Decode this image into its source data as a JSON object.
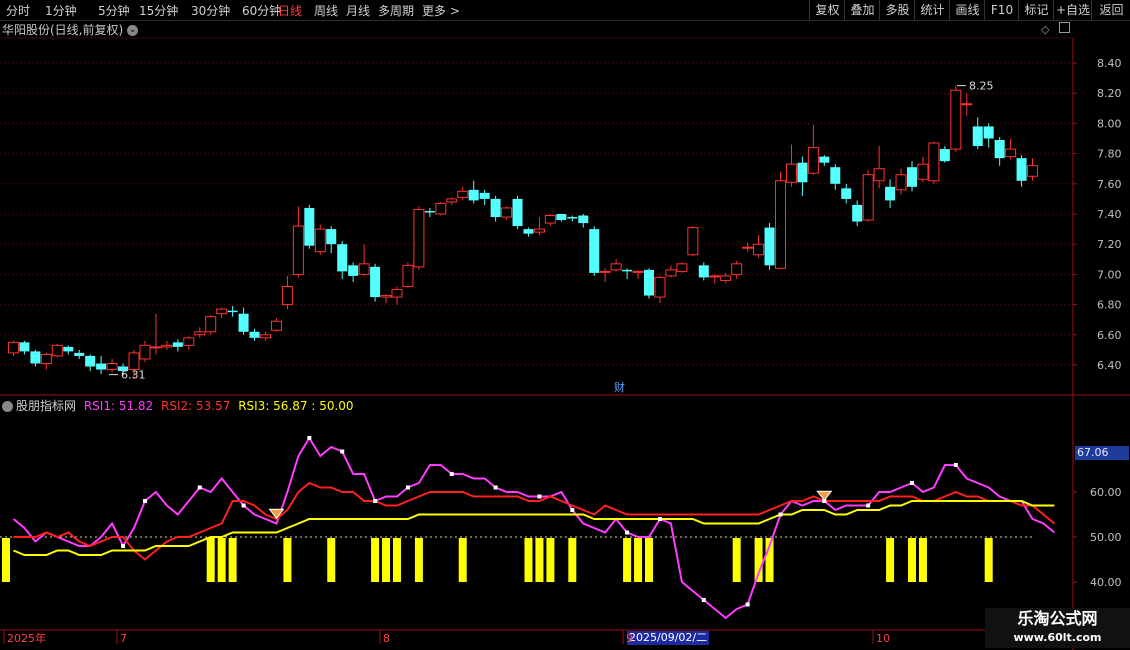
{
  "toolbar": {
    "periods": [
      "分时",
      "1分钟",
      "5分钟",
      "15分钟",
      "30分钟",
      "60分钟",
      "日线",
      "周线",
      "月线",
      "多周期",
      "更多 >"
    ],
    "active_period": "日线",
    "right_buttons": [
      "复权",
      "叠加",
      "多股",
      "统计",
      "画线",
      "F10",
      "标记",
      "+自选",
      "返回"
    ]
  },
  "main_title": "华阳股份(日线,前复权)",
  "indicator": {
    "name": "股朋指标网",
    "rsi1_label": "RSI1: 51.82",
    "rsi2_label": "RSI2: 53.57",
    "rsi3_label": "RSI3: 56.87",
    "ref_label": ": 50.00",
    "readout": "67.06"
  },
  "colors": {
    "up": "#ff3232",
    "down": "#54ffff",
    "rsi1": "#ff3cff",
    "rsi2": "#ff2020",
    "rsi3": "#ffff00",
    "axis": "#a01010",
    "bars": "#ffff00"
  },
  "x_labels": [
    "2025年",
    "7",
    "8",
    "9",
    "10"
  ],
  "date_tag": "2025/09/02/二",
  "event_markers": [
    "",
    "财"
  ],
  "watermark": {
    "line1": "乐淘公式网",
    "line2": "www.60lt.com"
  },
  "chart_data": [
    {
      "type": "candlestick",
      "title": "华阳股份(日线,前复权)",
      "ylim": [
        6.3,
        8.5
      ],
      "y_ticks": [
        6.4,
        6.6,
        6.8,
        7.0,
        7.2,
        7.4,
        7.6,
        7.8,
        8.0,
        8.2,
        8.4
      ],
      "annotations": [
        {
          "text": "8.25",
          "value": 8.25
        },
        {
          "text": "6.31",
          "value": 6.31
        }
      ],
      "candles": [
        [
          6.48,
          6.55,
          6.56,
          6.46
        ],
        [
          6.55,
          6.49,
          6.56,
          6.47
        ],
        [
          6.49,
          6.41,
          6.5,
          6.39
        ],
        [
          6.41,
          6.47,
          6.48,
          6.37
        ],
        [
          6.46,
          6.53,
          6.54,
          6.45
        ],
        [
          6.52,
          6.49,
          6.53,
          6.47
        ],
        [
          6.48,
          6.46,
          6.5,
          6.44
        ],
        [
          6.46,
          6.39,
          6.47,
          6.36
        ],
        [
          6.41,
          6.37,
          6.46,
          6.34
        ],
        [
          6.37,
          6.41,
          6.44,
          6.35
        ],
        [
          6.39,
          6.36,
          6.41,
          6.33
        ],
        [
          6.37,
          6.48,
          6.5,
          6.31
        ],
        [
          6.44,
          6.53,
          6.56,
          6.42
        ],
        [
          6.52,
          6.52,
          6.74,
          6.47
        ],
        [
          6.52,
          6.53,
          6.56,
          6.5
        ],
        [
          6.55,
          6.52,
          6.57,
          6.49
        ],
        [
          6.53,
          6.58,
          6.59,
          6.5
        ],
        [
          6.6,
          6.62,
          6.65,
          6.58
        ],
        [
          6.62,
          6.72,
          6.73,
          6.6
        ],
        [
          6.74,
          6.77,
          6.78,
          6.71
        ],
        [
          6.76,
          6.75,
          6.79,
          6.72
        ],
        [
          6.74,
          6.62,
          6.78,
          6.6
        ],
        [
          6.62,
          6.58,
          6.64,
          6.56
        ],
        [
          6.58,
          6.6,
          6.62,
          6.56
        ],
        [
          6.63,
          6.69,
          6.71,
          6.62
        ],
        [
          6.8,
          6.92,
          6.99,
          6.77
        ],
        [
          7.0,
          7.32,
          7.45,
          6.98
        ],
        [
          7.44,
          7.19,
          7.46,
          7.17
        ],
        [
          7.15,
          7.3,
          7.33,
          7.13
        ],
        [
          7.3,
          7.2,
          7.32,
          7.14
        ],
        [
          7.2,
          7.02,
          7.22,
          6.97
        ],
        [
          7.06,
          6.99,
          7.08,
          6.95
        ],
        [
          7.0,
          7.07,
          7.2,
          6.99
        ],
        [
          7.05,
          6.85,
          7.07,
          6.82
        ],
        [
          6.85,
          6.86,
          6.87,
          6.81
        ],
        [
          6.85,
          6.9,
          6.92,
          6.8
        ],
        [
          6.92,
          7.06,
          7.08,
          6.91
        ],
        [
          7.05,
          7.43,
          7.45,
          7.03
        ],
        [
          7.42,
          7.41,
          7.44,
          7.38
        ],
        [
          7.4,
          7.47,
          7.48,
          7.39
        ],
        [
          7.48,
          7.5,
          7.51,
          7.46
        ],
        [
          7.51,
          7.55,
          7.58,
          7.49
        ],
        [
          7.56,
          7.49,
          7.62,
          7.47
        ],
        [
          7.54,
          7.5,
          7.56,
          7.46
        ],
        [
          7.5,
          7.38,
          7.52,
          7.35
        ],
        [
          7.38,
          7.44,
          7.45,
          7.36
        ],
        [
          7.5,
          7.32,
          7.52,
          7.3
        ],
        [
          7.3,
          7.27,
          7.31,
          7.25
        ],
        [
          7.28,
          7.3,
          7.38,
          7.26
        ],
        [
          7.34,
          7.39,
          7.4,
          7.32
        ],
        [
          7.4,
          7.36,
          7.4,
          7.35
        ],
        [
          7.38,
          7.37,
          7.39,
          7.35
        ],
        [
          7.39,
          7.34,
          7.4,
          7.31
        ],
        [
          7.3,
          7.01,
          7.32,
          6.99
        ],
        [
          7.02,
          7.02,
          7.04,
          6.95
        ],
        [
          7.03,
          7.07,
          7.1,
          7.02
        ],
        [
          7.03,
          7.02,
          7.04,
          6.97
        ],
        [
          7.02,
          7.02,
          7.03,
          6.97
        ],
        [
          7.03,
          6.86,
          7.04,
          6.84
        ],
        [
          6.85,
          6.98,
          6.99,
          6.81
        ],
        [
          6.99,
          7.03,
          7.06,
          6.98
        ],
        [
          7.02,
          7.07,
          7.08,
          7.01
        ],
        [
          7.13,
          7.31,
          7.32,
          7.12
        ],
        [
          7.06,
          6.98,
          7.08,
          6.96
        ],
        [
          6.99,
          6.99,
          7.0,
          6.94
        ],
        [
          6.96,
          6.99,
          7.01,
          6.94
        ],
        [
          7.0,
          7.07,
          7.09,
          6.97
        ],
        [
          7.18,
          7.18,
          7.21,
          7.15
        ],
        [
          7.13,
          7.2,
          7.26,
          7.11
        ],
        [
          7.31,
          7.06,
          7.34,
          7.03
        ],
        [
          7.04,
          7.62,
          7.68,
          7.04
        ],
        [
          7.61,
          7.73,
          7.86,
          7.58
        ],
        [
          7.74,
          7.61,
          7.78,
          7.52
        ],
        [
          7.67,
          7.84,
          7.99,
          7.66
        ],
        [
          7.78,
          7.74,
          7.79,
          7.72
        ],
        [
          7.71,
          7.6,
          7.73,
          7.56
        ],
        [
          7.57,
          7.5,
          7.6,
          7.47
        ],
        [
          7.46,
          7.35,
          7.49,
          7.32
        ],
        [
          7.36,
          7.66,
          7.69,
          7.35
        ],
        [
          7.62,
          7.7,
          7.85,
          7.57
        ],
        [
          7.58,
          7.49,
          7.63,
          7.44
        ],
        [
          7.56,
          7.66,
          7.7,
          7.53
        ],
        [
          7.71,
          7.58,
          7.75,
          7.55
        ],
        [
          7.63,
          7.73,
          7.78,
          7.61
        ],
        [
          7.62,
          7.87,
          7.88,
          7.6
        ],
        [
          7.83,
          7.75,
          7.85,
          7.74
        ],
        [
          7.83,
          8.22,
          8.25,
          7.81
        ],
        [
          8.13,
          8.13,
          8.2,
          8.05
        ],
        [
          7.98,
          7.85,
          8.04,
          7.83
        ],
        [
          7.98,
          7.9,
          8.0,
          7.84
        ],
        [
          7.89,
          7.77,
          7.91,
          7.72
        ],
        [
          7.78,
          7.83,
          7.9,
          7.76
        ],
        [
          7.77,
          7.62,
          7.79,
          7.58
        ],
        [
          7.65,
          7.72,
          7.77,
          7.62
        ]
      ]
    },
    {
      "type": "line",
      "title": "股朋指标网",
      "ylim": [
        35,
        75
      ],
      "y_ticks": [
        40,
        50,
        60
      ],
      "y_tick_labels": [
        "40.00",
        "50.00",
        "60.00"
      ],
      "reference_line": 50,
      "series": [
        {
          "name": "RSI1",
          "values": [
            54,
            52,
            49,
            51,
            50,
            49,
            48,
            48,
            50,
            53,
            48,
            52,
            58,
            60,
            57,
            55,
            58,
            61,
            60,
            63,
            60,
            57,
            55,
            54,
            53,
            60,
            68,
            72,
            68,
            70,
            69,
            64,
            64,
            58,
            59,
            59,
            61,
            62,
            66,
            66,
            64,
            64,
            63,
            63,
            61,
            60,
            60,
            59,
            59,
            59,
            60,
            56,
            53,
            52,
            51,
            54,
            51,
            50,
            50,
            54,
            53,
            40,
            38,
            36,
            34,
            32,
            34,
            35,
            42,
            48,
            55,
            58,
            57,
            58,
            58,
            56,
            57,
            57,
            57,
            60,
            60,
            61,
            62,
            60,
            61,
            66,
            66,
            63,
            62,
            61,
            59,
            58,
            58,
            54,
            53,
            51
          ]
        },
        {
          "name": "RSI2",
          "values": [
            50,
            50,
            50,
            51,
            50,
            51,
            49,
            48,
            49,
            50,
            50,
            47,
            45,
            47,
            49,
            50,
            50,
            51,
            52,
            53,
            58,
            58,
            57,
            55,
            54,
            56,
            60,
            62,
            61,
            61,
            60,
            60,
            58,
            58,
            57,
            57,
            58,
            59,
            60,
            60,
            60,
            60,
            59,
            59,
            59,
            59,
            59,
            58,
            58,
            59,
            58,
            57,
            56,
            55,
            57,
            56,
            55,
            55,
            55,
            55,
            55,
            55,
            55,
            55,
            55,
            55,
            55,
            55,
            55,
            56,
            57,
            58,
            58,
            59,
            58,
            58,
            58,
            58,
            58,
            58,
            59,
            59,
            59,
            58,
            58,
            59,
            60,
            59,
            59,
            58,
            58,
            58,
            57,
            57,
            55,
            53
          ]
        },
        {
          "name": "RSI3",
          "values": [
            47,
            46,
            46,
            46,
            47,
            47,
            46,
            46,
            46,
            47,
            47,
            47,
            47,
            48,
            48,
            48,
            48,
            49,
            50,
            50,
            51,
            51,
            51,
            51,
            51,
            52,
            53,
            54,
            54,
            54,
            54,
            54,
            54,
            54,
            54,
            54,
            54,
            55,
            55,
            55,
            55,
            55,
            55,
            55,
            55,
            55,
            55,
            55,
            55,
            55,
            55,
            55,
            55,
            54,
            54,
            54,
            54,
            54,
            54,
            54,
            54,
            54,
            54,
            53,
            53,
            53,
            53,
            53,
            53,
            54,
            55,
            55,
            56,
            56,
            56,
            55,
            55,
            56,
            56,
            56,
            57,
            57,
            58,
            58,
            58,
            58,
            58,
            58,
            58,
            58,
            58,
            58,
            58,
            57,
            57,
            57
          ]
        }
      ]
    }
  ],
  "signal_bars_idx": [
    18,
    19,
    20,
    25,
    29,
    33,
    34,
    35,
    37,
    41,
    47,
    48,
    49,
    51,
    56,
    57,
    58,
    66,
    68,
    69,
    80,
    82,
    83,
    89
  ]
}
